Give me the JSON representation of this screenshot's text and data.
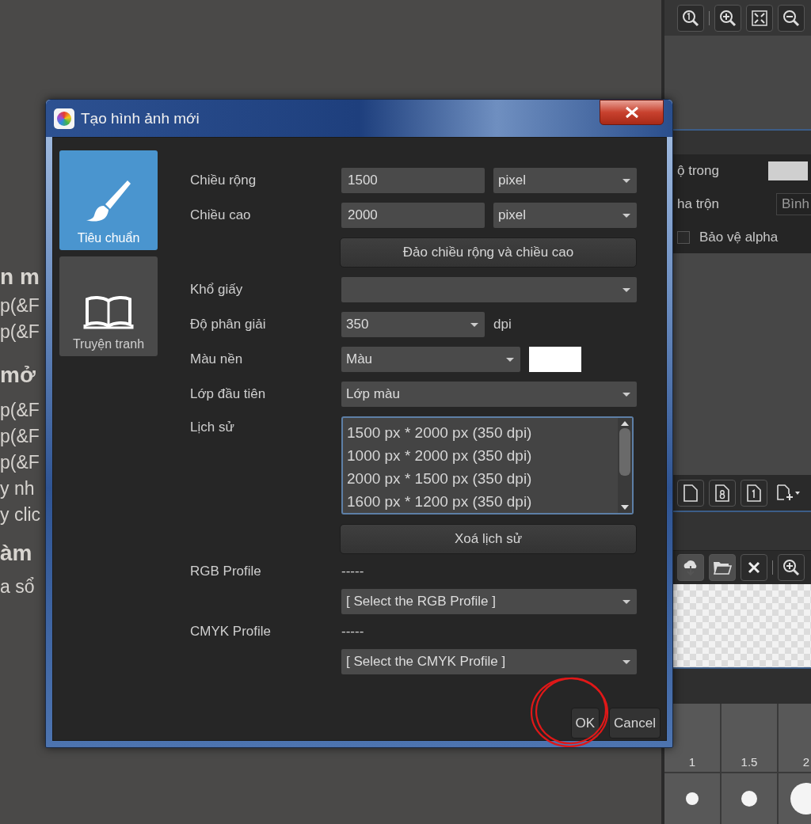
{
  "background_document": {
    "lines": [
      {
        "kind": "heading",
        "text": "n m"
      },
      {
        "kind": "text",
        "text": "p(&F"
      },
      {
        "kind": "text",
        "text": "p(&F"
      },
      {
        "kind": "heading",
        "text": "mở"
      },
      {
        "kind": "text",
        "text": "p(&F"
      },
      {
        "kind": "text",
        "text": "p(&F"
      },
      {
        "kind": "text",
        "text": "p(&F"
      },
      {
        "kind": "text",
        "text": "y nh"
      },
      {
        "kind": "text",
        "text": "y clic"
      },
      {
        "kind": "heading",
        "text": "àm"
      },
      {
        "kind": "text",
        "text": "a sổ"
      }
    ]
  },
  "right_panel": {
    "layer_properties": {
      "opacity_label": "ộ trong",
      "blend_label": "ha trộn",
      "blend_value": "Bình",
      "protect_alpha": {
        "label": "Bảo vệ alpha",
        "checked": false
      }
    },
    "brush_sizes": [
      {
        "label": "1"
      },
      {
        "label": "1.5"
      },
      {
        "label": "2"
      }
    ]
  },
  "dialog": {
    "title": "Tạo hình ảnh mới",
    "tabs": [
      {
        "kind": "brush",
        "label": "Tiêu chuẩn",
        "selected": true
      },
      {
        "kind": "book",
        "label": "Truyện tranh",
        "selected": false
      }
    ],
    "width": {
      "label": "Chiều rộng",
      "value": "1500",
      "unit": "pixel"
    },
    "height": {
      "label": "Chiều cao",
      "value": "2000",
      "unit": "pixel"
    },
    "swap_button": "Đảo chiều rộng và chiều cao",
    "paper_size": {
      "label": "Khổ giấy"
    },
    "resolution": {
      "label": "Độ phân giải",
      "value": "350",
      "unit": "dpi"
    },
    "background_color": {
      "label": "Màu nền",
      "value": "Màu"
    },
    "first_layer": {
      "label": "Lớp đầu tiên",
      "value": "Lớp màu"
    },
    "history": {
      "label": "Lịch sử",
      "items": [
        {
          "text": "1500 px * 2000 px (350 dpi)",
          "selected": false
        },
        {
          "text": "1000 px * 2000 px (350 dpi)",
          "selected": false
        },
        {
          "text": "2000 px * 1500 px (350 dpi)",
          "selected": false
        },
        {
          "text": "1600 px * 1200 px (350 dpi)",
          "selected": false
        }
      ]
    },
    "clear_history_button": "Xoá lịch sử",
    "rgb_profile": {
      "label": "RGB Profile",
      "current": "-----",
      "value": "[ Select the RGB Profile ]"
    },
    "cmyk_profile": {
      "label": "CMYK Profile",
      "current": "-----",
      "value": "[ Select the CMYK Profile ]"
    },
    "buttons": [
      {
        "label": "OK"
      },
      {
        "label": "Cancel"
      }
    ]
  }
}
